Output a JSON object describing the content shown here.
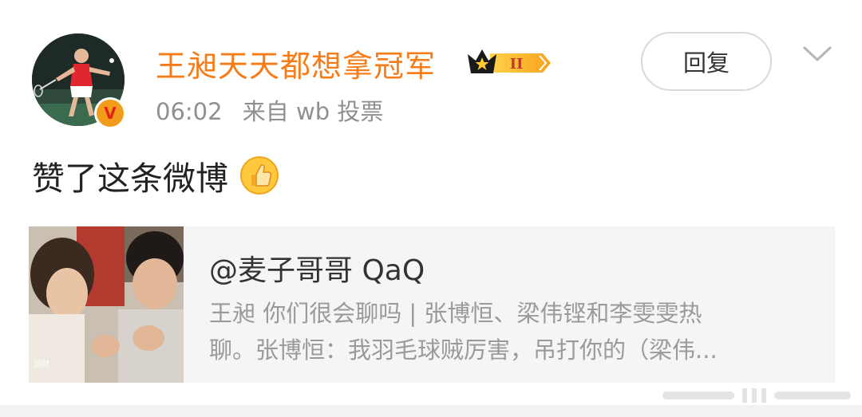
{
  "post": {
    "username": "王昶天天都想拿冠军",
    "vip_level": "II",
    "time": "06:02",
    "source": "来自 wb 投票",
    "reply_label": "回复",
    "text": "赞了这条微博"
  },
  "quote": {
    "author": "@麦子哥哥 QaQ",
    "desc_lines": [
      "王昶 你们很会聊吗 | 张博恒、梁伟铿和李雯雯热",
      "聊。张博恒：我羽毛球贼厉害，吊打你的（梁伟..."
    ],
    "thumb_caption": "回财"
  },
  "colors": {
    "username": "#f77b16",
    "meta": "#8f8f8f",
    "card_bg": "#f5f5f5",
    "verified": "#f39c1c"
  },
  "icons": {
    "verified": "verified-v-icon",
    "vip": "crown-vip-icon",
    "thumbs_up": "thumbs-up-emoji",
    "more": "chevron-down-icon"
  }
}
